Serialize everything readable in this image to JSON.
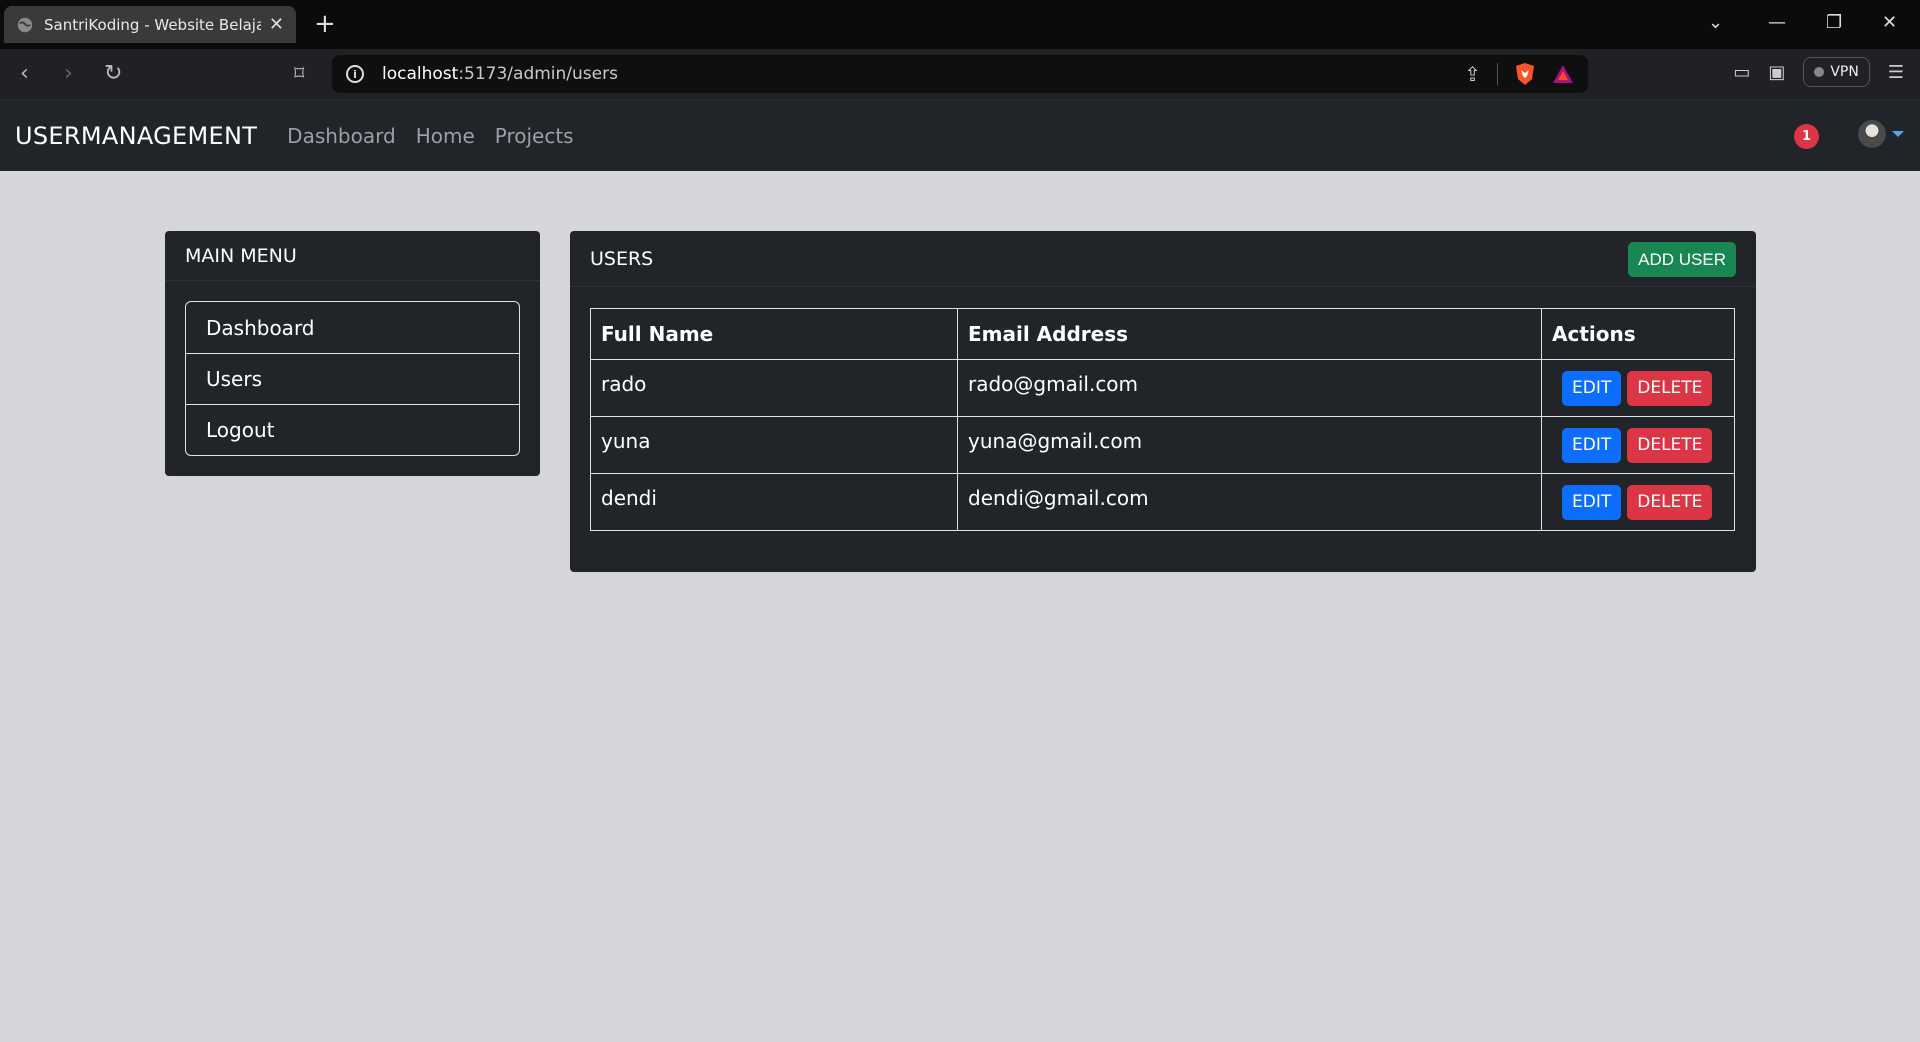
{
  "browser": {
    "tab_title": "SantriKoding - Website Belajar C",
    "new_tab": "+",
    "address_host": "localhost",
    "address_path": ":5173/admin/users",
    "vpn_label": "VPN"
  },
  "app": {
    "brand": "USERMANAGEMENT",
    "nav_links": [
      "Dashboard",
      "Home",
      "Projects"
    ],
    "notification_count": "1"
  },
  "menu": {
    "title": "MAIN MENU",
    "items": [
      "Dashboard",
      "Users",
      "Logout"
    ]
  },
  "users": {
    "title": "USERS",
    "add_label": "ADD USER",
    "columns": [
      "Full Name",
      "Email Address",
      "Actions"
    ],
    "rows": [
      {
        "name": "rado",
        "email": "rado@gmail.com"
      },
      {
        "name": "yuna",
        "email": "yuna@gmail.com"
      },
      {
        "name": "dendi",
        "email": "dendi@gmail.com"
      }
    ],
    "edit_label": "EDIT",
    "delete_label": "DELETE"
  },
  "colors": {
    "navbar": "#212529",
    "page_bg": "#d6d5d9",
    "add_button": "#198754",
    "edit_button": "#0d6efd",
    "delete_button": "#dc3545"
  }
}
